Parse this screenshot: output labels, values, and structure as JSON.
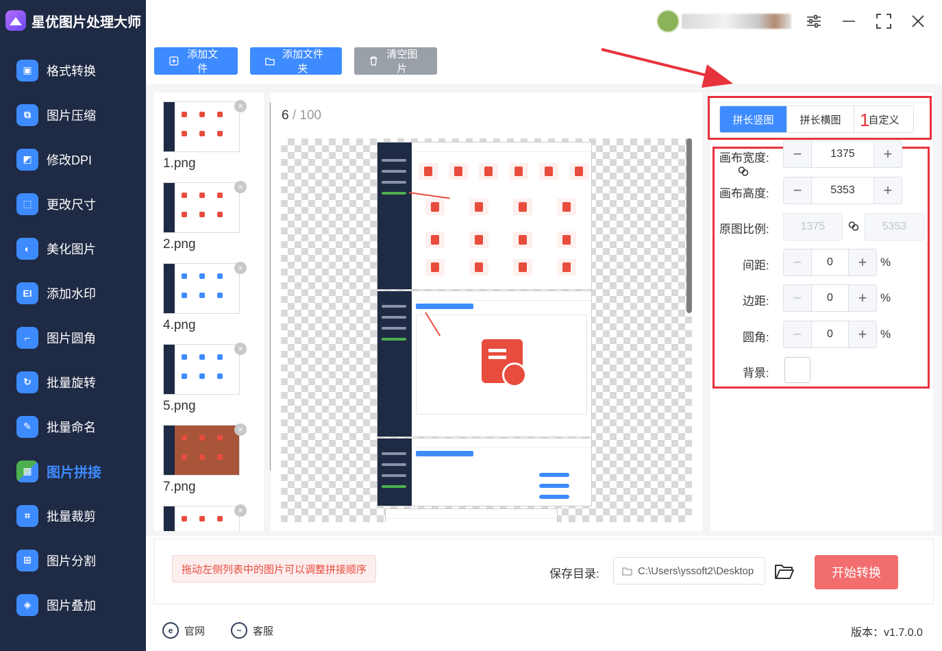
{
  "app": {
    "title": "星优图片处理大师"
  },
  "sidebar": {
    "items": [
      {
        "label": "格式转换",
        "icon": "image-convert-icon",
        "color": "#3d8bff"
      },
      {
        "label": "图片压缩",
        "icon": "image-compress-icon",
        "color": "#3d8bff"
      },
      {
        "label": "修改DPI",
        "icon": "dpi-icon",
        "color": "#3d8bff"
      },
      {
        "label": "更改尺寸",
        "icon": "resize-icon",
        "color": "#3d8bff"
      },
      {
        "label": "美化图片",
        "icon": "beautify-icon",
        "color": "#3d8bff"
      },
      {
        "label": "添加水印",
        "icon": "watermark-icon",
        "color": "#3d8bff"
      },
      {
        "label": "图片圆角",
        "icon": "round-corner-icon",
        "color": "#3d8bff"
      },
      {
        "label": "批量旋转",
        "icon": "rotate-icon",
        "color": "#3d8bff"
      },
      {
        "label": "批量命名",
        "icon": "rename-icon",
        "color": "#3d8bff"
      },
      {
        "label": "图片拼接",
        "icon": "puzzle-icon",
        "color": "#4caf50",
        "active": true
      },
      {
        "label": "批量裁剪",
        "icon": "crop-icon",
        "color": "#3d8bff"
      },
      {
        "label": "图片分割",
        "icon": "split-icon",
        "color": "#3d8bff"
      },
      {
        "label": "图片叠加",
        "icon": "layers-icon",
        "color": "#3d8bff"
      }
    ]
  },
  "toolbar": {
    "add_file": "添加文件",
    "add_folder": "添加文件夹",
    "clear": "清空图片"
  },
  "thumbnails": [
    {
      "label": "1.png"
    },
    {
      "label": "2.png"
    },
    {
      "label": "4.png"
    },
    {
      "label": "5.png"
    },
    {
      "label": "7.png"
    },
    {
      "label": ""
    }
  ],
  "preview": {
    "current": "6",
    "separator": "/",
    "total": "100"
  },
  "settings": {
    "tabs": [
      "拼长竖图",
      "拼长横图",
      "自定义"
    ],
    "active_tab": 0,
    "annotation_number": "1",
    "canvas_width_label": "画布宽度:",
    "canvas_width": "1375",
    "canvas_height_label": "画布高度:",
    "canvas_height": "5353",
    "ratio_label": "原图比例:",
    "ratio_width": "1375",
    "ratio_height": "5353",
    "spacing_label": "间距:",
    "spacing": "0",
    "margin_label": "边距:",
    "margin": "0",
    "radius_label": "圆角:",
    "radius": "0",
    "percent": "%",
    "bg_label": "背景:",
    "bg_color": "#ffffff"
  },
  "bottom": {
    "hint": "拖动左侧列表中的图片可以调整拼接顺序",
    "save_label": "保存目录:",
    "save_path": "C:\\Users\\yssoft2\\Desktop",
    "start": "开始转换"
  },
  "footer": {
    "website": "官网",
    "support": "客服",
    "version": "版本：v1.7.0.0"
  }
}
